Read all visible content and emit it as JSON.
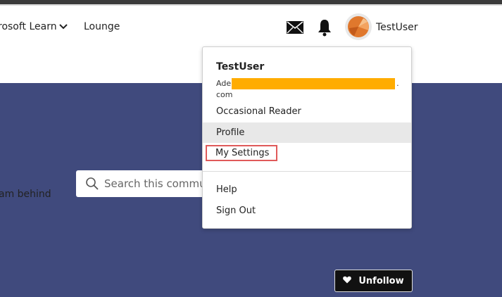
{
  "nav": {
    "learn_label": "rosoft Learn",
    "lounge_label": "Lounge",
    "username": "TestUser",
    "icons": [
      "mail-icon",
      "bell-icon",
      "chevron-down-icon"
    ]
  },
  "hero": {
    "text_fragment": "am behind",
    "background_color": "#404a7d"
  },
  "search": {
    "placeholder": "Search this commun"
  },
  "follow_button": {
    "label": "Unfollow",
    "icon": "heart-icon"
  },
  "user_menu": {
    "name": "TestUser",
    "email_start": "Ade",
    "email_end": ".",
    "email_line2": "com",
    "rank": "Occasional Reader",
    "items": {
      "profile": "Profile",
      "settings": "My Settings",
      "help": "Help",
      "signout": "Sign Out"
    },
    "highlight_color": "#e05a5a",
    "redaction_color": "#ffac00"
  }
}
